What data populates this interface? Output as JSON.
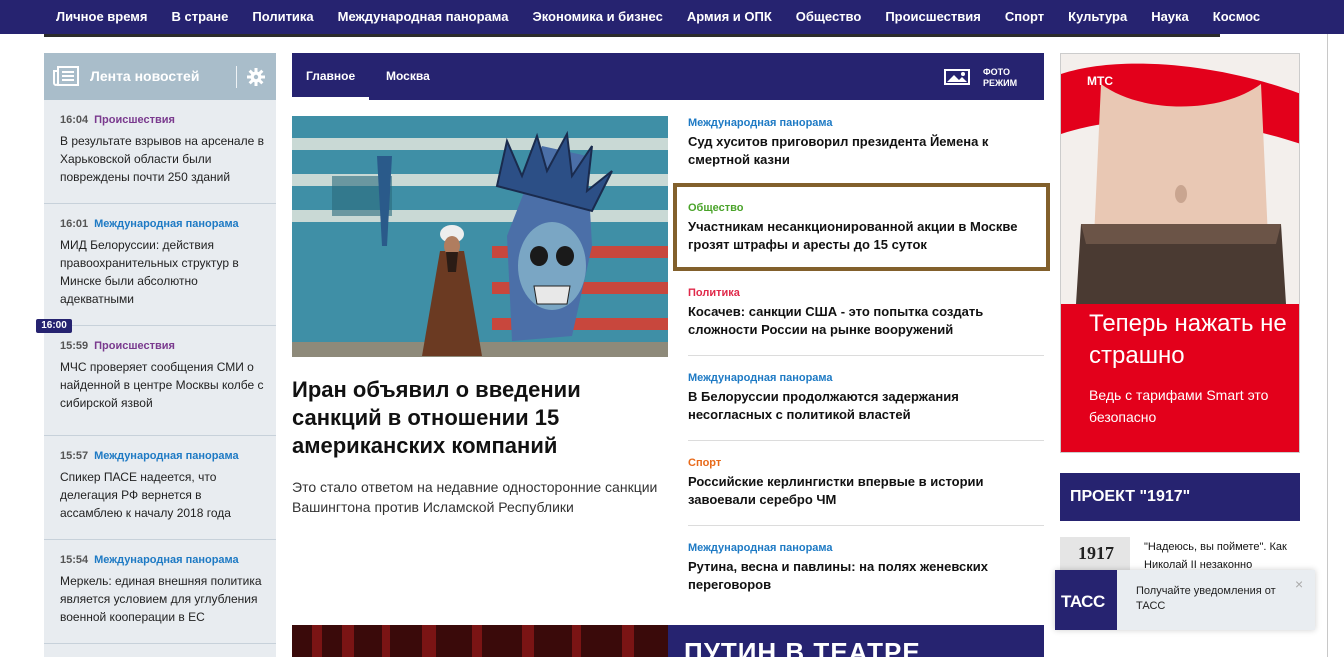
{
  "nav": {
    "items": [
      "Личное время",
      "В стране",
      "Политика",
      "Международная панорама",
      "Экономика и бизнес",
      "Армия и ОПК",
      "Общество",
      "Происшествия",
      "Спорт",
      "Культура",
      "Наука",
      "Космос"
    ]
  },
  "feed": {
    "title": "Лента новостей",
    "marker": "16:00",
    "items": [
      {
        "time": "16:04",
        "category": "Происшествия",
        "text": "В результате взрывов на арсенале в Харьковской области были повреждены почти 250 зданий"
      },
      {
        "time": "16:01",
        "category": "Международная панорама",
        "text": "МИД Белоруссии: действия правоохранительных структур в Минске были абсолютно адекватными"
      },
      {
        "time": "15:59",
        "category": "Происшествия",
        "text": "МЧС проверяет сообщения СМИ о найденной в центре Москвы колбе с сибирской язвой"
      },
      {
        "time": "15:57",
        "category": "Международная панорама",
        "text": "Спикер ПАСЕ надеется, что делегация РФ вернется в ассамблею к началу 2018 года"
      },
      {
        "time": "15:54",
        "category": "Международная панорама",
        "text": "Меркель: единая внешняя политика является условием для углубления военной кооперации в ЕС"
      }
    ]
  },
  "tabs": {
    "main": "Главное",
    "moscow": "Москва",
    "photo_mode": "ФОТО РЕЖИМ"
  },
  "main_story": {
    "title": "Иран объявил о введении санкций в отношении 15 американских компаний",
    "lead": "Это стало ответом на недавние односторонние санкции Вашингтона против Исламской Республики"
  },
  "headlines": [
    {
      "category": "Международная панорама",
      "color": "#1e7ac4",
      "title": "Суд хуситов приговорил президента Йемена к смертной казни"
    },
    {
      "category": "Общество",
      "color": "#4aa32a",
      "title": "Участникам несанкционированной акции в Москве грозят штрафы и аресты до 15 суток"
    },
    {
      "category": "Политика",
      "color": "#e0294a",
      "title": "Косачев: санкции США - это попытка создать сложности России на рынке вооружений"
    },
    {
      "category": "Международная панорама",
      "color": "#1e7ac4",
      "title": "В Белоруссии продолжаются задержания несогласных с политикой властей"
    },
    {
      "category": "Спорт",
      "color": "#e86a1a",
      "title": "Российские керлингистки впервые в истории завоевали серебро ЧМ"
    },
    {
      "category": "Международная панорама",
      "color": "#1e7ac4",
      "title": "Рутина, весна и павлины: на полях женевских переговоров"
    }
  ],
  "bottom_banner": {
    "text": "ПУТИН В ТЕАТРЕ"
  },
  "ad": {
    "brand": "МТС",
    "headline": "Теперь нажать не страшно",
    "subline": "Ведь с тарифами Smart это безопасно"
  },
  "project": {
    "title": "ПРОЕКТ \"1917\"",
    "thumb_number": "1917",
    "teaser": "\"Надеюсь, вы поймете\". Как Николай II незаконно"
  },
  "notification": {
    "logo": "ТАСС",
    "text": "Получайте уведомления от ТАСС",
    "close": "×"
  }
}
